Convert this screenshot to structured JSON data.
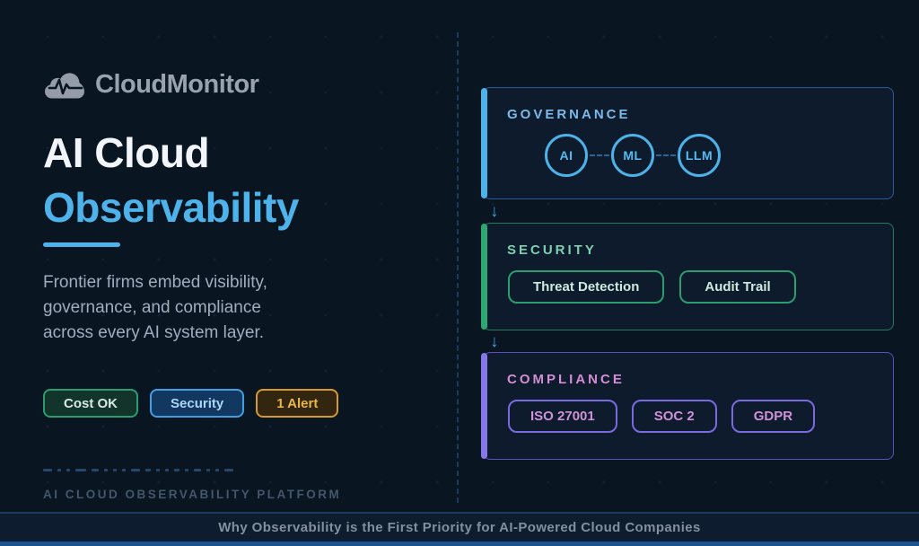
{
  "brand": {
    "name": "CloudMonitor"
  },
  "hero": {
    "title_line1": "AI Cloud",
    "title_line2": "Observability",
    "description": "Frontier firms embed visibility, governance, and compliance across every AI system layer.",
    "accent_color": "#4db3ea"
  },
  "badges": [
    {
      "label": "Cost OK",
      "color": "#2a9d6e"
    },
    {
      "label": "Security",
      "color": "#449fe0"
    },
    {
      "label": "1 Alert",
      "color": "#d69a2e"
    }
  ],
  "platform_label": "AI CLOUD OBSERVABILITY PLATFORM",
  "diagram": {
    "panels": [
      {
        "title": "GOVERNANCE",
        "accent_color": "#4db2e8",
        "nodes": [
          "AI",
          "ML",
          "LLM"
        ]
      },
      {
        "title": "SECURITY",
        "accent_color": "#2ea873",
        "chips": [
          "Threat Detection",
          "Audit Trail"
        ]
      },
      {
        "title": "COMPLIANCE",
        "accent_color": "#8678e8",
        "chips": [
          "ISO 27001",
          "SOC 2",
          "GDPR"
        ]
      }
    ],
    "arrow_glyph": "↓"
  },
  "footer": {
    "title": "Why Observability is the First Priority for AI-Powered Cloud Companies"
  }
}
